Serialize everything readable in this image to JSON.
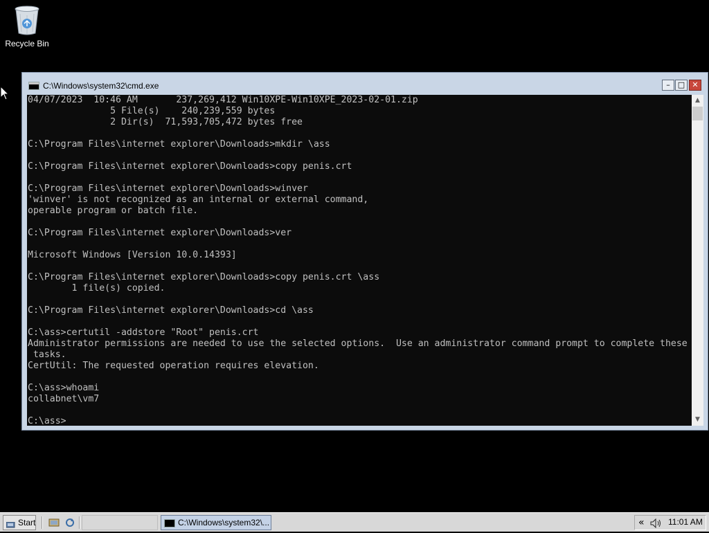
{
  "desktop": {
    "recycle_bin_label": "Recycle Bin"
  },
  "window": {
    "title": "C:\\Windows\\system32\\cmd.exe",
    "minimize_glyph": "–",
    "maximize_glyph": "□",
    "close_glyph": "✕",
    "console_lines": [
      "04/07/2023  10:46 AM       237,269,412 Win10XPE-Win10XPE_2023-02-01.zip",
      "               5 File(s)    240,239,559 bytes",
      "               2 Dir(s)  71,593,705,472 bytes free",
      "",
      "C:\\Program Files\\internet explorer\\Downloads>mkdir \\ass",
      "",
      "C:\\Program Files\\internet explorer\\Downloads>copy penis.crt",
      "",
      "C:\\Program Files\\internet explorer\\Downloads>winver",
      "'winver' is not recognized as an internal or external command,",
      "operable program or batch file.",
      "",
      "C:\\Program Files\\internet explorer\\Downloads>ver",
      "",
      "Microsoft Windows [Version 10.0.14393]",
      "",
      "C:\\Program Files\\internet explorer\\Downloads>copy penis.crt \\ass",
      "        1 file(s) copied.",
      "",
      "C:\\Program Files\\internet explorer\\Downloads>cd \\ass",
      "",
      "C:\\ass>certutil -addstore \"Root\" penis.crt",
      "Administrator permissions are needed to use the selected options.  Use an administrator command prompt to complete these",
      " tasks.",
      "CertUtil: The requested operation requires elevation.",
      "",
      "C:\\ass>whoami",
      "collabnet\\vm7",
      "",
      "C:\\ass>"
    ]
  },
  "scrollbar": {
    "up_glyph": "▲",
    "down_glyph": "▼"
  },
  "taskbar": {
    "start_label": "Start",
    "task_button_label": "C:\\Windows\\system32\\...",
    "tray_chevron": "«",
    "clock": "11:01 AM"
  },
  "icons": {
    "recycle_bin": "recycle-bin-icon",
    "cmd": "cmd-icon",
    "start": "start-icon",
    "quick_launch_1": "explorer-icon",
    "quick_launch_2": "refresh-icon",
    "speaker": "speaker-icon",
    "cursor": "mouse-pointer-icon"
  }
}
